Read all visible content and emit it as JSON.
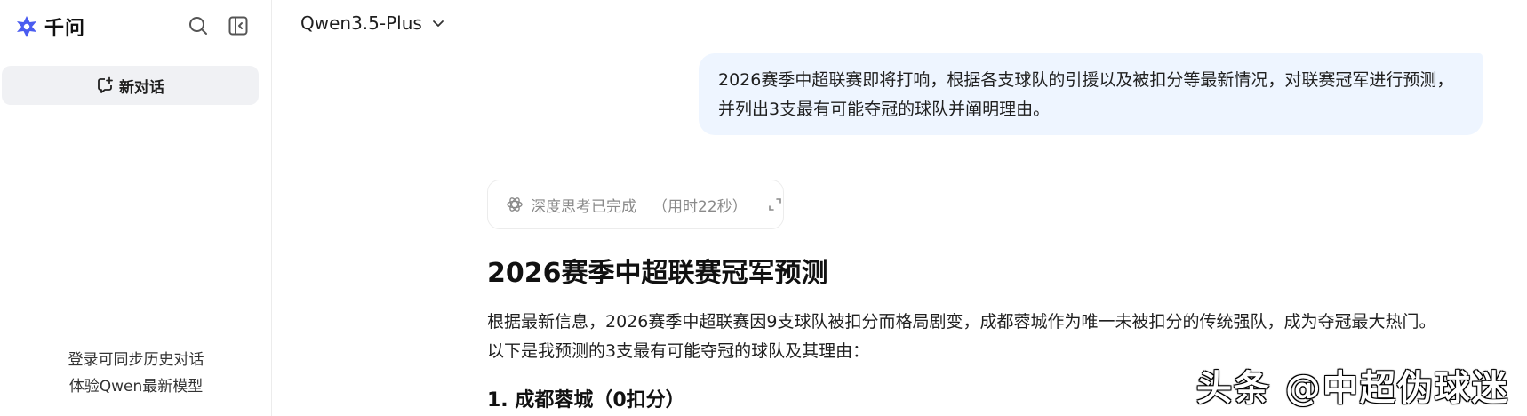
{
  "sidebar": {
    "brand_name": "千问",
    "new_chat_label": "新对话",
    "login_hint_line1": "登录可同步历史对话",
    "login_hint_line2": "体验Qwen最新模型"
  },
  "header": {
    "model_name": "Qwen3.5-Plus"
  },
  "conversation": {
    "user_message": "2026赛季中超联赛即将打响，根据各支球队的引援以及被扣分等最新情况，对联赛冠军进行预测，并列出3支最有可能夺冠的球队并阐明理由。",
    "thinking_label": "深度思考已完成",
    "thinking_time": "（用时22秒）",
    "answer_title": "2026赛季中超联赛冠军预测",
    "answer_paragraph_line1": "根据最新信息，2026赛季中超联赛因9支球队被扣分而格局剧变，成都蓉城作为唯一未被扣分的传统强队，成为夺冠最大热门。",
    "answer_paragraph_line2": "以下是我预测的3支最有可能夺冠的球队及其理由：",
    "answer_heading_1": "1. 成都蓉城（0扣分）"
  },
  "watermark": {
    "text": "头条 @中超伪球迷"
  },
  "colors": {
    "brand": "#4a5cf0",
    "user_bubble": "#eef5ff",
    "new_chat_bg": "#f0f1f4"
  },
  "icons": {
    "logo": "qwen-star-icon",
    "search": "search-icon",
    "collapse": "sidebar-collapse-icon",
    "new_chat": "new-chat-icon",
    "model_dropdown": "chevron-down-icon",
    "thinking": "brain-icon",
    "expand": "expand-icon"
  }
}
